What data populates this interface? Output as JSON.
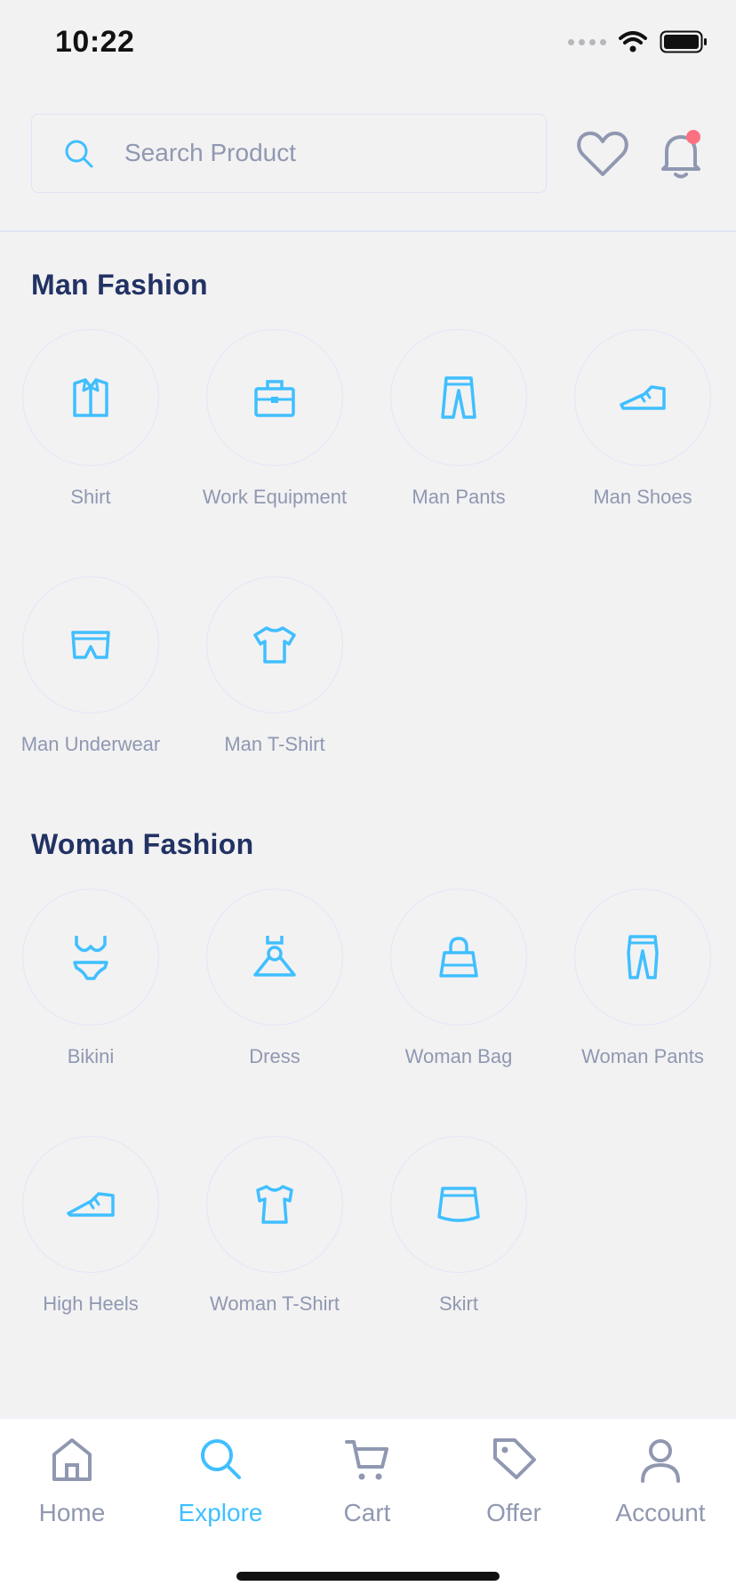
{
  "status_bar": {
    "time": "10:22"
  },
  "search": {
    "placeholder": "Search Product"
  },
  "sections": [
    {
      "title": "Man Fashion",
      "items": [
        {
          "label": "Shirt",
          "icon": "shirt-icon"
        },
        {
          "label": "Work Equipment",
          "icon": "briefcase-icon"
        },
        {
          "label": "Man Pants",
          "icon": "pants-icon"
        },
        {
          "label": "Man Shoes",
          "icon": "shoe-icon"
        },
        {
          "label": "Man Underwear",
          "icon": "underwear-icon"
        },
        {
          "label": "Man T-Shirt",
          "icon": "tshirt-icon"
        }
      ]
    },
    {
      "title": "Woman Fashion",
      "items": [
        {
          "label": "Bikini",
          "icon": "bikini-icon"
        },
        {
          "label": "Dress",
          "icon": "dress-icon"
        },
        {
          "label": "Woman Bag",
          "icon": "bag-icon"
        },
        {
          "label": "Woman Pants",
          "icon": "pants-icon"
        },
        {
          "label": "High Heels",
          "icon": "heels-icon"
        },
        {
          "label": "Woman T-Shirt",
          "icon": "woman-tshirt-icon"
        },
        {
          "label": "Skirt",
          "icon": "skirt-icon"
        }
      ]
    }
  ],
  "bottom_nav": [
    {
      "label": "Home",
      "icon": "home-icon",
      "active": false
    },
    {
      "label": "Explore",
      "icon": "search-icon",
      "active": true
    },
    {
      "label": "Cart",
      "icon": "cart-icon",
      "active": false
    },
    {
      "label": "Offer",
      "icon": "tag-icon",
      "active": false
    },
    {
      "label": "Account",
      "icon": "user-icon",
      "active": false
    }
  ],
  "colors": {
    "accent": "#40bfff",
    "heading": "#223263",
    "muted": "#9098b1",
    "border": "#dfe3f5",
    "notification": "#fb7181"
  }
}
